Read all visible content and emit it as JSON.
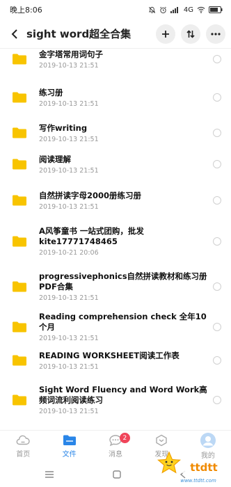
{
  "status_bar": {
    "time": "晚上8:06",
    "network": "4G"
  },
  "header": {
    "title": "sight word超全合集"
  },
  "colors": {
    "accent": "#2a86e8",
    "folder": "#f8c400",
    "badge": "#f0455a"
  },
  "files": [
    {
      "name": "金字塔常用词句子",
      "date": "2019-10-13  21:51"
    },
    {
      "name": "练习册",
      "date": "2019-10-13  21:51"
    },
    {
      "name": "写作writing",
      "date": "2019-10-13  21:51"
    },
    {
      "name": "阅读理解",
      "date": "2019-10-13  21:51"
    },
    {
      "name": "自然拼读字母2000册练习册",
      "date": "2019-10-13  21:51"
    },
    {
      "name": "A风筝童书 一站式团购，批发kite17771748465",
      "date": "2019-10-21  20:06"
    },
    {
      "name": "progressivephonics自然拼读教材和练习册PDF合集",
      "date": "2019-10-13  21:51"
    },
    {
      "name": "Reading comprehension check 全年10个月",
      "date": "2019-10-13  21:51"
    },
    {
      "name": "READING WORKSHEET阅读工作表",
      "date": "2019-10-13  21:51"
    },
    {
      "name": "Sight Word Fluency and Word Work高频词流利阅读练习",
      "date": "2019-10-13  21:51"
    }
  ],
  "bottom_nav": [
    {
      "label": "首页",
      "icon": "cloud-icon"
    },
    {
      "label": "文件",
      "icon": "folder-icon"
    },
    {
      "label": "消息",
      "icon": "chat-icon",
      "badge": "2"
    },
    {
      "label": "发现",
      "icon": "discover-icon"
    },
    {
      "label": "我的",
      "icon": "avatar-icon"
    }
  ],
  "watermark": {
    "text": "ttdtt",
    "site": "www.ttdtt.com"
  }
}
